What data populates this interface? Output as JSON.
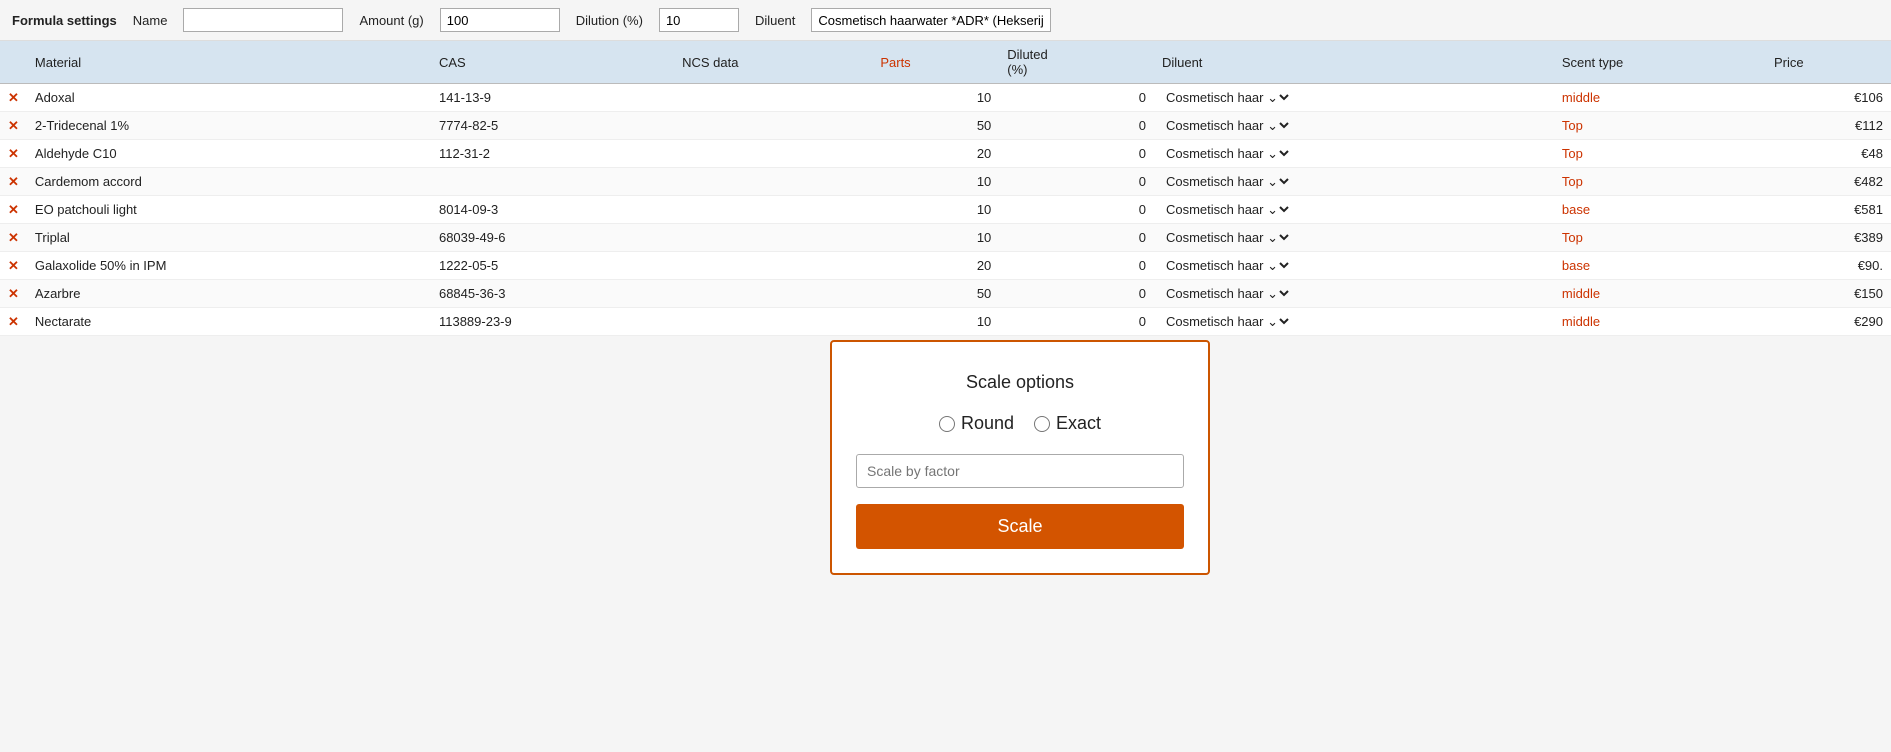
{
  "header": {
    "formula_settings_label": "Formula settings",
    "name_label": "Name",
    "name_value": "",
    "name_placeholder": "",
    "amount_label": "Amount (g)",
    "amount_value": "100",
    "dilution_label": "Dilution (%)",
    "dilution_value": "10",
    "diluent_label": "Diluent",
    "diluent_value": "Cosmetisch haarwater *ADR* (Hekserij*)"
  },
  "table": {
    "columns": [
      {
        "key": "remove",
        "label": ""
      },
      {
        "key": "material",
        "label": "Material"
      },
      {
        "key": "cas",
        "label": "CAS"
      },
      {
        "key": "ncs_data",
        "label": "NCS data"
      },
      {
        "key": "parts",
        "label": "Parts"
      },
      {
        "key": "diluted",
        "label": "Diluted (%)"
      },
      {
        "key": "diluent",
        "label": "Diluent"
      },
      {
        "key": "scent_type",
        "label": "Scent type"
      },
      {
        "key": "price",
        "label": "Price"
      }
    ],
    "rows": [
      {
        "material": "Adoxal",
        "cas": "141-13-9",
        "ncs_data": "",
        "parts": "10",
        "diluted": "0",
        "diluent": "Cosmetisch haar",
        "scent_type": "middle",
        "price": "€106"
      },
      {
        "material": "2-Tridecenal 1%",
        "cas": "7774-82-5",
        "ncs_data": "",
        "parts": "50",
        "diluted": "0",
        "diluent": "Cosmetisch haar",
        "scent_type": "Top",
        "price": "€112"
      },
      {
        "material": "Aldehyde C10",
        "cas": "112-31-2",
        "ncs_data": "",
        "parts": "20",
        "diluted": "0",
        "diluent": "Cosmetisch haar",
        "scent_type": "Top",
        "price": "€48"
      },
      {
        "material": "Cardemom accord",
        "cas": "",
        "ncs_data": "",
        "parts": "10",
        "diluted": "0",
        "diluent": "Cosmetisch haar",
        "scent_type": "Top",
        "price": "€482"
      },
      {
        "material": "EO patchouli light",
        "cas": "8014-09-3",
        "ncs_data": "",
        "parts": "10",
        "diluted": "0",
        "diluent": "Cosmetisch haar",
        "scent_type": "base",
        "price": "€581"
      },
      {
        "material": "Triplal",
        "cas": "68039-49-6",
        "ncs_data": "",
        "parts": "10",
        "diluted": "0",
        "diluent": "Cosmetisch haar",
        "scent_type": "Top",
        "price": "€389"
      },
      {
        "material": "Galaxolide 50% in IPM",
        "cas": "1222-05-5",
        "ncs_data": "",
        "parts": "20",
        "diluted": "0",
        "diluent": "Cosmetisch haar",
        "scent_type": "base",
        "price": "€90."
      },
      {
        "material": "Azarbre",
        "cas": "68845-36-3",
        "ncs_data": "",
        "parts": "50",
        "diluted": "0",
        "diluent": "Cosmetisch haar",
        "scent_type": "middle",
        "price": "€150"
      },
      {
        "material": "Nectarate",
        "cas": "113889-23-9",
        "ncs_data": "",
        "parts": "10",
        "diluted": "0",
        "diluent": "Cosmetisch haar",
        "scent_type": "middle",
        "price": "€290"
      }
    ]
  },
  "modal": {
    "title": "Scale options",
    "round_label": "Round",
    "exact_label": "Exact",
    "factor_placeholder": "Scale by factor",
    "scale_button_label": "Scale"
  }
}
